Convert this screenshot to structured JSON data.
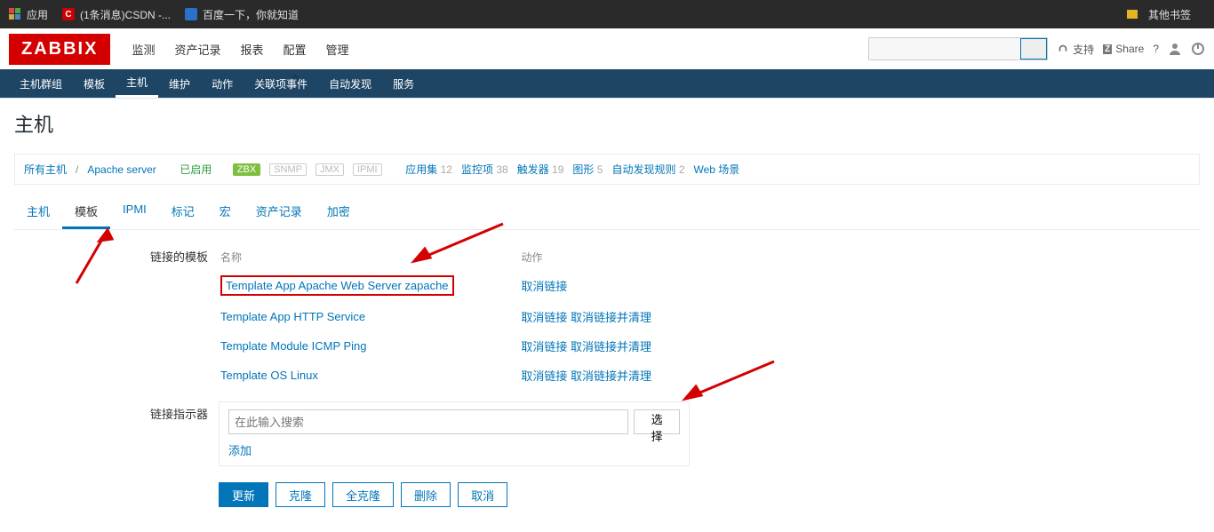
{
  "browser": {
    "bookmarks": [
      {
        "label": "应用"
      },
      {
        "label": "(1条消息)CSDN -..."
      },
      {
        "label": "百度一下，你就知道"
      }
    ],
    "other_bookmarks": "其他书签"
  },
  "brand": "ZABBIX",
  "top_menu": [
    {
      "label": "监测",
      "active": false
    },
    {
      "label": "资产记录",
      "active": false
    },
    {
      "label": "报表",
      "active": false
    },
    {
      "label": "配置",
      "active": true
    },
    {
      "label": "管理",
      "active": false
    }
  ],
  "top_right": {
    "support": "支持",
    "share": "Share",
    "help": "?"
  },
  "sub_nav": [
    {
      "label": "主机群组",
      "active": false
    },
    {
      "label": "模板",
      "active": false
    },
    {
      "label": "主机",
      "active": true
    },
    {
      "label": "维护",
      "active": false
    },
    {
      "label": "动作",
      "active": false
    },
    {
      "label": "关联项事件",
      "active": false
    },
    {
      "label": "自动发现",
      "active": false
    },
    {
      "label": "服务",
      "active": false
    }
  ],
  "page_title": "主机",
  "breadcrumb": {
    "all_hosts": "所有主机",
    "host_name": "Apache server",
    "status": "已启用",
    "tag_zbx": "ZBX",
    "tag_snmp": "SNMP",
    "tag_jmx": "JMX",
    "tag_ipmi": "IPMI",
    "stats": [
      {
        "label": "应用集",
        "count": "12"
      },
      {
        "label": "监控项",
        "count": "38"
      },
      {
        "label": "触发器",
        "count": "19"
      },
      {
        "label": "图形",
        "count": "5"
      },
      {
        "label": "自动发现规则",
        "count": "2"
      },
      {
        "label": "Web 场景",
        "count": ""
      }
    ]
  },
  "tabs": [
    {
      "label": "主机",
      "active": false
    },
    {
      "label": "模板",
      "active": true
    },
    {
      "label": "IPMI",
      "active": false
    },
    {
      "label": "标记",
      "active": false
    },
    {
      "label": "宏",
      "active": false
    },
    {
      "label": "资产记录",
      "active": false
    },
    {
      "label": "加密",
      "active": false
    }
  ],
  "form": {
    "linked_templates_label": "链接的模板",
    "col_name": "名称",
    "col_action": "动作",
    "templates": [
      {
        "name": "Template App Apache Web Server zapache",
        "highlighted": true,
        "actions": [
          {
            "t": "取消链接"
          }
        ]
      },
      {
        "name": "Template App HTTP Service",
        "highlighted": false,
        "actions": [
          {
            "t": "取消链接"
          },
          {
            "t": "取消链接并清理"
          }
        ]
      },
      {
        "name": "Template Module ICMP Ping",
        "highlighted": false,
        "actions": [
          {
            "t": "取消链接"
          },
          {
            "t": "取消链接并清理"
          }
        ]
      },
      {
        "name": "Template OS Linux",
        "highlighted": false,
        "actions": [
          {
            "t": "取消链接"
          },
          {
            "t": "取消链接并清理"
          }
        ]
      }
    ],
    "link_indicator_label": "链接指示器",
    "search_placeholder": "在此输入搜索",
    "select_button": "选择",
    "add_link": "添加"
  },
  "buttons": {
    "update": "更新",
    "clone": "克隆",
    "full_clone": "全克隆",
    "delete": "删除",
    "cancel": "取消"
  }
}
